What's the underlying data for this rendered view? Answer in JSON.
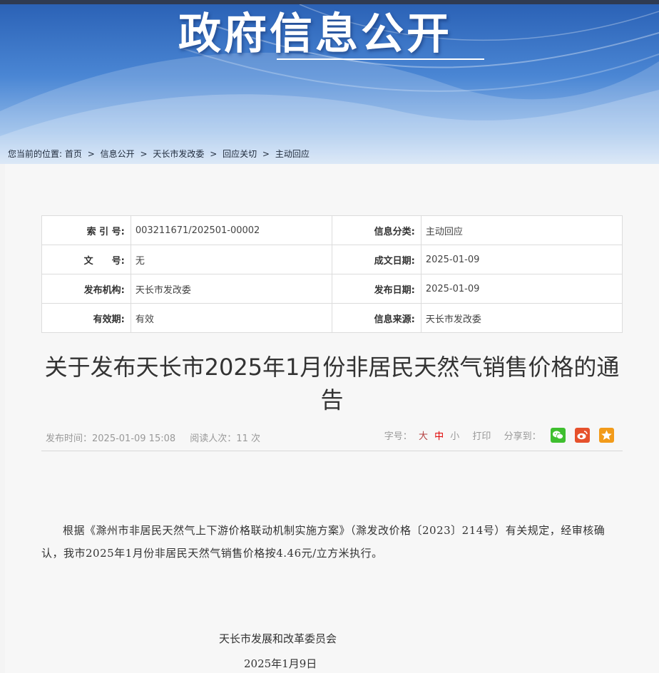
{
  "banner": {
    "title": "政府信息公开"
  },
  "breadcrumb": {
    "prefix": "您当前的位置:",
    "items": [
      "首页",
      "信息公开",
      "天长市发改委",
      "回应关切",
      "主动回应"
    ],
    "separator": ">"
  },
  "meta": {
    "rows": [
      {
        "k1": "索 引 号:",
        "v1": "003211671/202501-00002",
        "k2": "信息分类:",
        "v2": "主动回应"
      },
      {
        "k1": "文　　号:",
        "v1": "无",
        "k2": "成文日期:",
        "v2": "2025-01-09"
      },
      {
        "k1": "发布机构:",
        "v1": "天长市发改委",
        "k2": "发布日期:",
        "v2": "2025-01-09"
      },
      {
        "k1": "有效期:",
        "v1": "有效",
        "k2": "信息来源:",
        "v2": "天长市发改委"
      }
    ]
  },
  "article": {
    "title": "关于发布天长市2025年1月份非居民天然气销售价格的通告",
    "publish_time": "发布时间：2025-01-09 15:08",
    "read_count": "阅读人次：11 次",
    "font_size_label": "字号：",
    "font_large": "大",
    "font_medium": "中",
    "font_small": "小",
    "print": "打印",
    "share_label": "分享到：",
    "body": "根据《滁州市非居民天然气上下游价格联动机制实施方案》（滁发改价格〔2023〕214号）有关规定，经审核确认，我市2025年1月份非居民天然气销售价格按4.46元/立方米执行。",
    "signature": "天长市发展和改革委员会",
    "date": "2025年1月9日"
  },
  "icons": {
    "wechat": "wechat-icon",
    "weibo": "weibo-icon",
    "favorite": "star-icon"
  },
  "colors": {
    "banner": "#3a74c6",
    "accent_red": "#e00000",
    "wechat": "#3fbf2f",
    "weibo": "#e6512c",
    "favorite": "#f29b1a"
  }
}
